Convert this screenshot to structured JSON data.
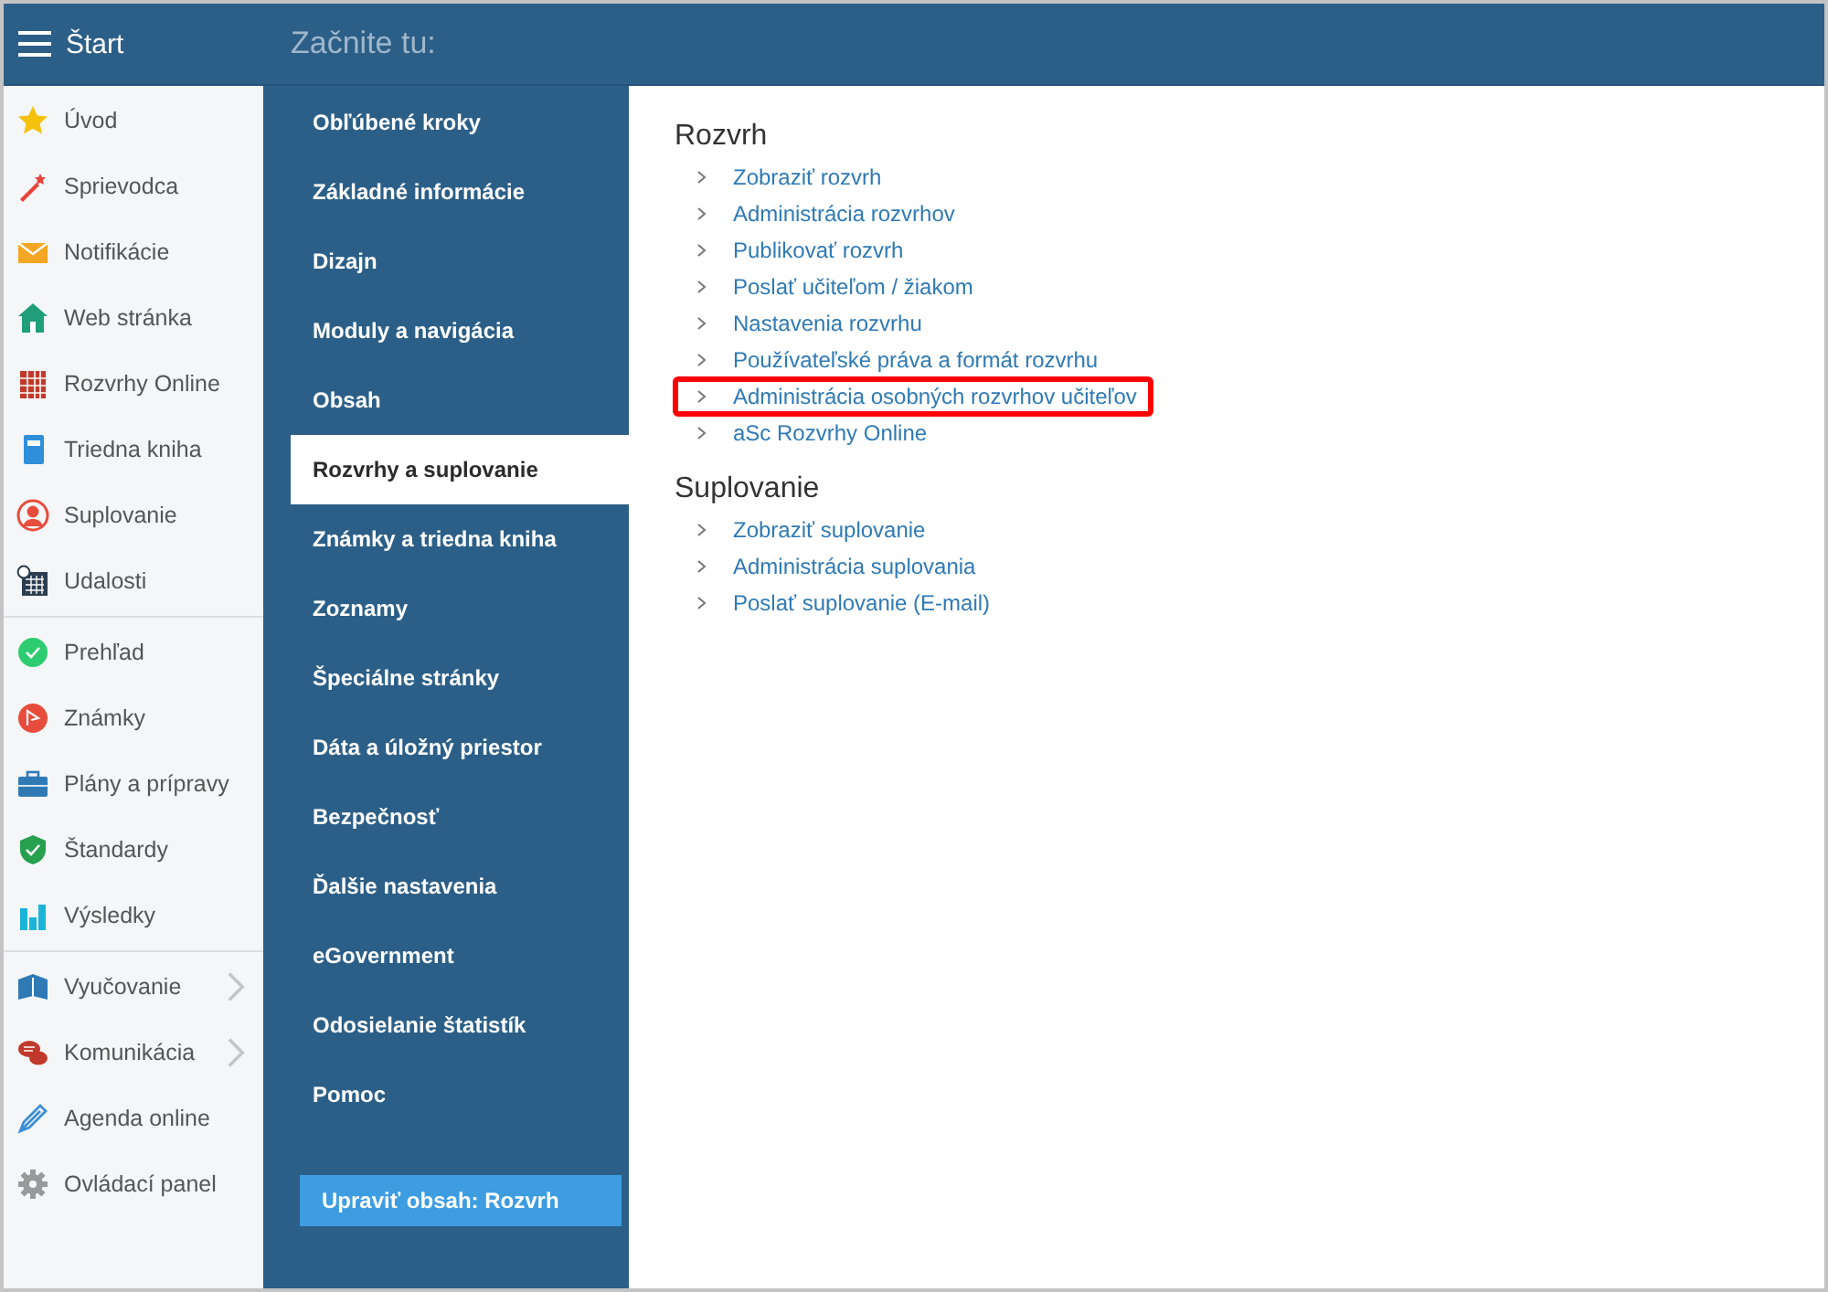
{
  "header": {
    "app_title": "Štart",
    "section_title": "Začnite tu:"
  },
  "sidebar": {
    "sections": [
      {
        "items": [
          {
            "label": "Úvod",
            "has_submenu": false
          },
          {
            "label": "Sprievodca",
            "has_submenu": false
          },
          {
            "label": "Notifikácie",
            "has_submenu": false
          },
          {
            "label": "Web stránka",
            "has_submenu": false
          },
          {
            "label": "Rozvrhy Online",
            "has_submenu": false
          },
          {
            "label": "Triedna kniha",
            "has_submenu": false
          },
          {
            "label": "Suplovanie",
            "has_submenu": false
          },
          {
            "label": "Udalosti",
            "has_submenu": false
          }
        ]
      },
      {
        "items": [
          {
            "label": "Prehľad",
            "has_submenu": false
          },
          {
            "label": "Známky",
            "has_submenu": false
          },
          {
            "label": "Plány a prípravy",
            "has_submenu": false
          },
          {
            "label": "Štandardy",
            "has_submenu": false
          },
          {
            "label": "Výsledky",
            "has_submenu": false
          }
        ]
      },
      {
        "items": [
          {
            "label": "Vyučovanie",
            "has_submenu": true
          },
          {
            "label": "Komunikácia",
            "has_submenu": true
          },
          {
            "label": "Agenda online",
            "has_submenu": false
          },
          {
            "label": "Ovládací panel",
            "has_submenu": false
          }
        ]
      }
    ]
  },
  "categories": [
    {
      "label": "Obľúbené kroky",
      "selected": false
    },
    {
      "label": "Základné informácie",
      "selected": false
    },
    {
      "label": "Dizajn",
      "selected": false
    },
    {
      "label": "Moduly a navigácia",
      "selected": false
    },
    {
      "label": "Obsah",
      "selected": false
    },
    {
      "label": "Rozvrhy a suplovanie",
      "selected": true
    },
    {
      "label": "Známky a triedna kniha",
      "selected": false
    },
    {
      "label": "Zoznamy",
      "selected": false
    },
    {
      "label": "Špeciálne stránky",
      "selected": false
    },
    {
      "label": "Dáta a úložný priestor",
      "selected": false
    },
    {
      "label": "Bezpečnosť",
      "selected": false
    },
    {
      "label": "Ďalšie nastavenia",
      "selected": false
    },
    {
      "label": "eGovernment",
      "selected": false
    },
    {
      "label": "Odosielanie štatistík",
      "selected": false
    },
    {
      "label": "Pomoc",
      "selected": false
    }
  ],
  "edit_button": "Upraviť obsah: Rozvrh",
  "groups": [
    {
      "title": "Rozvrh",
      "links": [
        {
          "label": "Zobraziť rozvrh",
          "highlighted": false
        },
        {
          "label": "Administrácia rozvrhov",
          "highlighted": false
        },
        {
          "label": "Publikovať rozvrh",
          "highlighted": false
        },
        {
          "label": "Poslať učiteľom / žiakom",
          "highlighted": false
        },
        {
          "label": "Nastavenia rozvrhu",
          "highlighted": false
        },
        {
          "label": "Používateľské práva a formát rozvrhu",
          "highlighted": false
        },
        {
          "label": "Administrácia osobných rozvrhov učiteľov",
          "highlighted": true
        },
        {
          "label": "aSc Rozvrhy Online",
          "highlighted": false
        }
      ]
    },
    {
      "title": "Suplovanie",
      "links": [
        {
          "label": "Zobraziť suplovanie",
          "highlighted": false
        },
        {
          "label": "Administrácia suplovania",
          "highlighted": false
        },
        {
          "label": "Poslať suplovanie (E-mail)",
          "highlighted": false
        }
      ]
    }
  ]
}
